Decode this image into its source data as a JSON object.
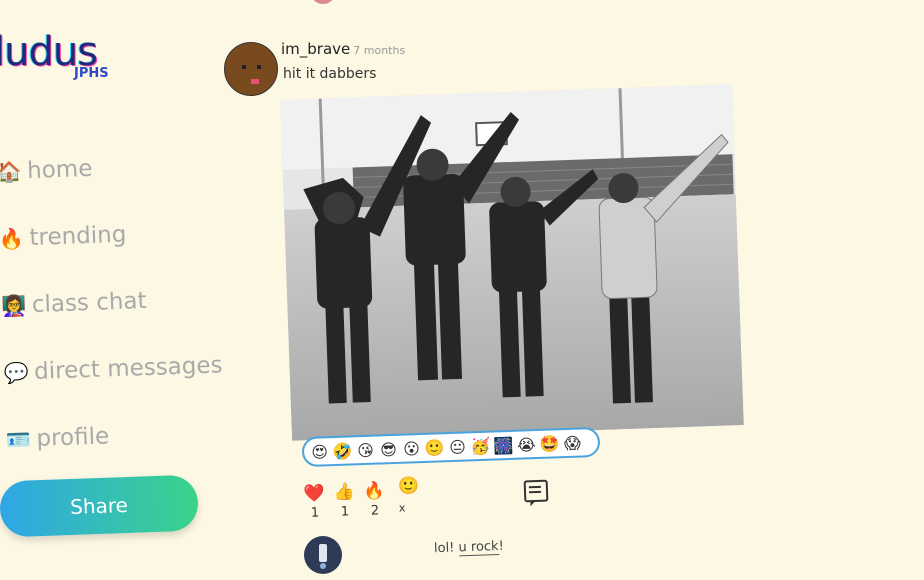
{
  "brand": {
    "name": "ludus",
    "school": "JPHS"
  },
  "nav": [
    {
      "label": "home",
      "icon": "house-icon",
      "glyph": "🏠"
    },
    {
      "label": "trending",
      "icon": "fire-icon",
      "glyph": "🔥"
    },
    {
      "label": "class chat",
      "icon": "class-chat-icon",
      "glyph": "👩‍🏫"
    },
    {
      "label": "direct messages",
      "icon": "messages-icon",
      "glyph": "💬"
    },
    {
      "label": "profile",
      "icon": "profile-icon",
      "glyph": "🪪"
    }
  ],
  "share_label": "Share",
  "post": {
    "author": "im_brave",
    "time": "7 months",
    "caption": "hit it dabbers",
    "reactions_bar": [
      "😍",
      "🤣",
      "😘",
      "😎",
      "😮",
      "🙂",
      "😐",
      "🥳",
      "🎆",
      "😭",
      "🤩",
      "😱"
    ],
    "counts": [
      {
        "emoji": "❤️",
        "icon": "heart-icon",
        "count": "1"
      },
      {
        "emoji": "👍",
        "icon": "thumbs-up-icon",
        "count": "1"
      },
      {
        "emoji": "🔥",
        "icon": "fire-icon",
        "count": "2"
      }
    ],
    "add_reaction": {
      "emoji": "🙂",
      "suffix": "x"
    },
    "comment": {
      "text_prefix": "lol! ",
      "text_link": "u rock",
      "text_suffix": "!"
    }
  },
  "colors": {
    "background": "#fdf8e4",
    "share_start": "#2fa6e6",
    "share_end": "#3ad38a",
    "reaction_border": "#4aa3df"
  }
}
